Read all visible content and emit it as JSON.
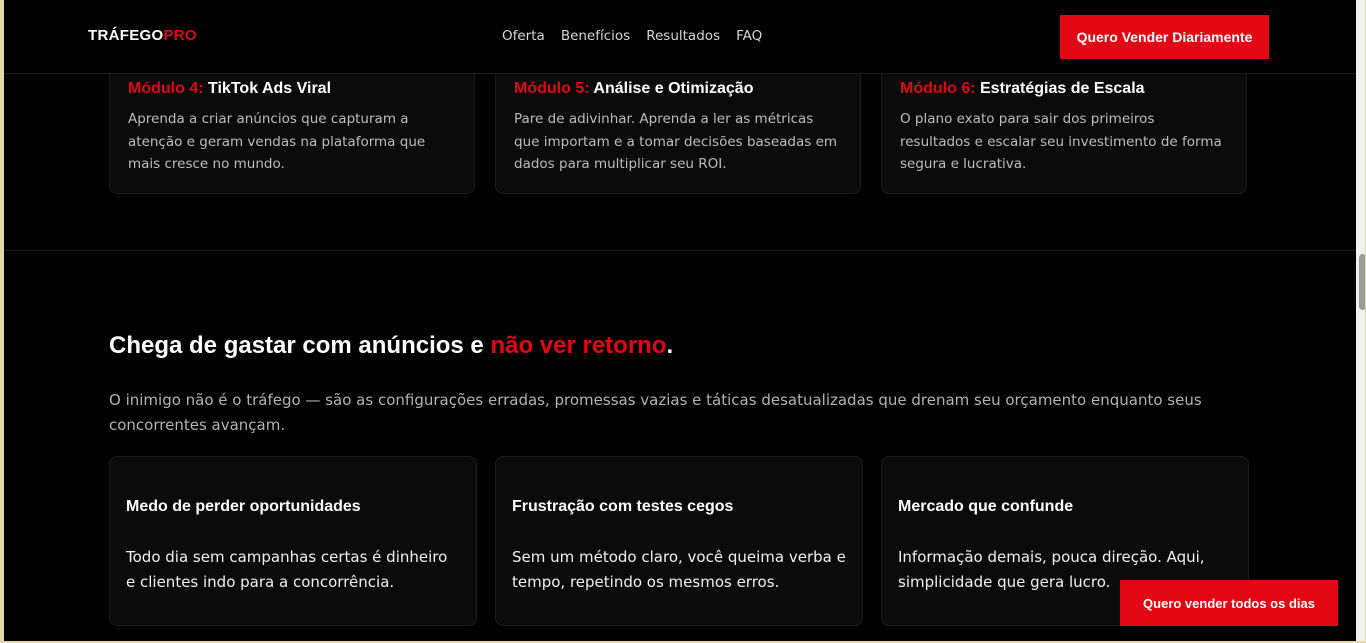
{
  "header": {
    "logo_bold": "TRÁFEGO",
    "logo_accent": "PRO",
    "nav": [
      {
        "label": "Oferta"
      },
      {
        "label": "Benefícios"
      },
      {
        "label": "Resultados"
      },
      {
        "label": "FAQ"
      }
    ],
    "cta_label": "Quero Vender Diariamente"
  },
  "modules": [
    {
      "tag": "Módulo 4:",
      "name": "TikTok Ads Viral",
      "description": "Aprenda a criar anúncios que capturam a atenção e geram vendas na plataforma que mais cresce no mundo."
    },
    {
      "tag": "Módulo 5:",
      "name": "Análise e Otimização",
      "description": "Pare de adivinhar. Aprenda a ler as métricas que importam e a tomar decisões baseadas em dados para multiplicar seu ROI."
    },
    {
      "tag": "Módulo 6:",
      "name": "Estratégias de Escala",
      "description": "O plano exato para sair dos primeiros resultados e escalar seu investimento de forma segura e lucrativa."
    }
  ],
  "pain": {
    "title_start": "Chega de gastar com anúncios e ",
    "title_highlight": "não ver retorno",
    "title_end": ".",
    "intro": "O inimigo não é o tráfego — são as configurações erradas, promessas vazias e táticas desatualizadas que drenam seu orçamento enquanto seus concorrentes avançam.",
    "cards": [
      {
        "title": "Medo de perder oportunidades",
        "text": "Todo dia sem campanhas certas é dinheiro e clientes indo para a concorrência."
      },
      {
        "title": "Frustração com testes cegos",
        "text": "Sem um método claro, você queima verba e tempo, repetindo os mesmos erros."
      },
      {
        "title": "Mercado que confunde",
        "text": "Informação demais, pouca direção. Aqui, simplicidade que gera lucro."
      }
    ]
  },
  "floating_cta": {
    "label": "Quero vender todos os dias"
  },
  "colors": {
    "accent": "#e30613",
    "background": "#000000",
    "card": "#0b0b0b"
  }
}
